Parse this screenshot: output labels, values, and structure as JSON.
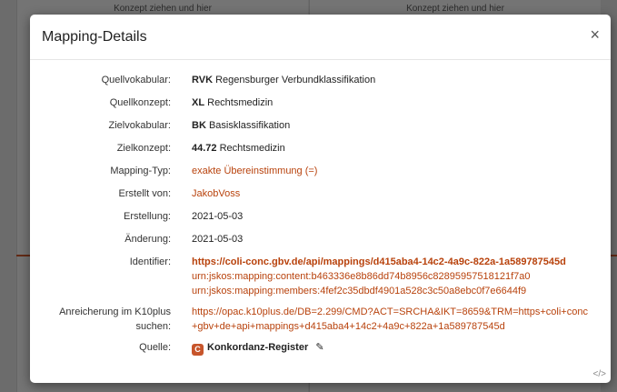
{
  "background": {
    "left_hint": "Konzept ziehen und hier",
    "right_hint": "Konzept ziehen und hier"
  },
  "modal": {
    "title": "Mapping-Details",
    "close_symbol": "×",
    "rows": {
      "quellvokabular": {
        "label": "Quellvokabular:",
        "notation": "RVK",
        "text": "Regensburger Verbundklassifikation"
      },
      "quellkonzept": {
        "label": "Quellkonzept:",
        "notation": "XL",
        "text": "Rechtsmedizin"
      },
      "zielvokabular": {
        "label": "Zielvokabular:",
        "notation": "BK",
        "text": "Basisklassifikation"
      },
      "zielkonzept": {
        "label": "Zielkonzept:",
        "notation": "44.72",
        "text": "Rechtsmedizin"
      },
      "mapping_typ": {
        "label": "Mapping-Typ:",
        "value": "exakte Übereinstimmung (=)"
      },
      "erstellt_von": {
        "label": "Erstellt von:",
        "value": "JakobVoss"
      },
      "erstellung": {
        "label": "Erstellung:",
        "value": "2021-05-03"
      },
      "aenderung": {
        "label": "Änderung:",
        "value": "2021-05-03"
      },
      "identifier": {
        "label": "Identifier:",
        "primary": "https://coli-conc.gbv.de/api/mappings/d415aba4-14c2-4a9c-822a-1a589787545d",
        "content": "urn:jskos:mapping:content:b463336e8b86dd74b8956c82895957518121f7a0",
        "members": "urn:jskos:mapping:members:4fef2c35dbdf4901a528c3c50a8ebc0f7e6644f9"
      },
      "anreicherung": {
        "label_line1": "Anreicherung im K10plus",
        "label_line2": "suchen:",
        "value": "https://opac.k10plus.de/DB=2.299/CMD?ACT=SRCHA&IKT=8659&TRM=https+coli+conc+gbv+de+api+mappings+d415aba4+14c2+4a9c+822a+1a589787545d"
      },
      "quelle": {
        "label": "Quelle:",
        "badge": "C",
        "value": "Konkordanz-Register",
        "edit_icon": "pencil-icon"
      }
    },
    "footer_icon": "</>"
  },
  "colors": {
    "accent": "#b8420c",
    "badge": "#c7552b"
  }
}
